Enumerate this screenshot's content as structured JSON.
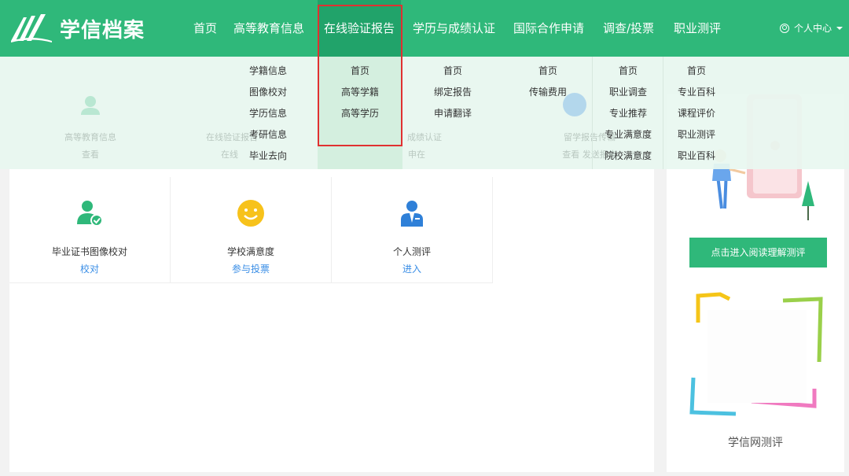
{
  "brand": {
    "name": "学信档案"
  },
  "nav": [
    {
      "label": "首页"
    },
    {
      "label": "高等教育信息"
    },
    {
      "label": "在线验证报告"
    },
    {
      "label": "学历与成绩认证"
    },
    {
      "label": "国际合作申请"
    },
    {
      "label": "调查/投票"
    },
    {
      "label": "职业测评"
    }
  ],
  "user": {
    "label": "个人中心"
  },
  "dropdown": {
    "col1": [
      "学籍信息",
      "图像校对",
      "学历信息",
      "考研信息",
      "毕业去向"
    ],
    "col2": [
      "首页",
      "高等学籍",
      "高等学历"
    ],
    "col3": [
      "首页",
      "绑定报告",
      "申请翻译"
    ],
    "col4": [
      "首页",
      "传输费用"
    ],
    "col5": [
      "首页",
      "职业调查",
      "专业推荐",
      "专业满意度",
      "院校满意度"
    ],
    "col6": [
      "首页",
      "专业百科",
      "课程评价",
      "职业测评",
      "职业百科"
    ]
  },
  "ghost": {
    "a_title": "高等教育信息",
    "a_link": "查看",
    "b_title": "在线验证报告",
    "b_link": "在线",
    "c_title": "成绩认证",
    "c_link": "申在",
    "d_title": "留学报告传输",
    "d_link": "查看 发送报告"
  },
  "cards": [
    {
      "title": "毕业证书图像校对",
      "link": "校对"
    },
    {
      "title": "学校满意度",
      "link": "参与投票"
    },
    {
      "title": "个人测评",
      "link": "进入"
    }
  ],
  "side": {
    "button": "点击进入阅读理解测评",
    "caption": "学信网测评"
  },
  "colors": {
    "brand": "#2fb87a",
    "link": "#3a8ee6",
    "highlight": "#e03131"
  }
}
